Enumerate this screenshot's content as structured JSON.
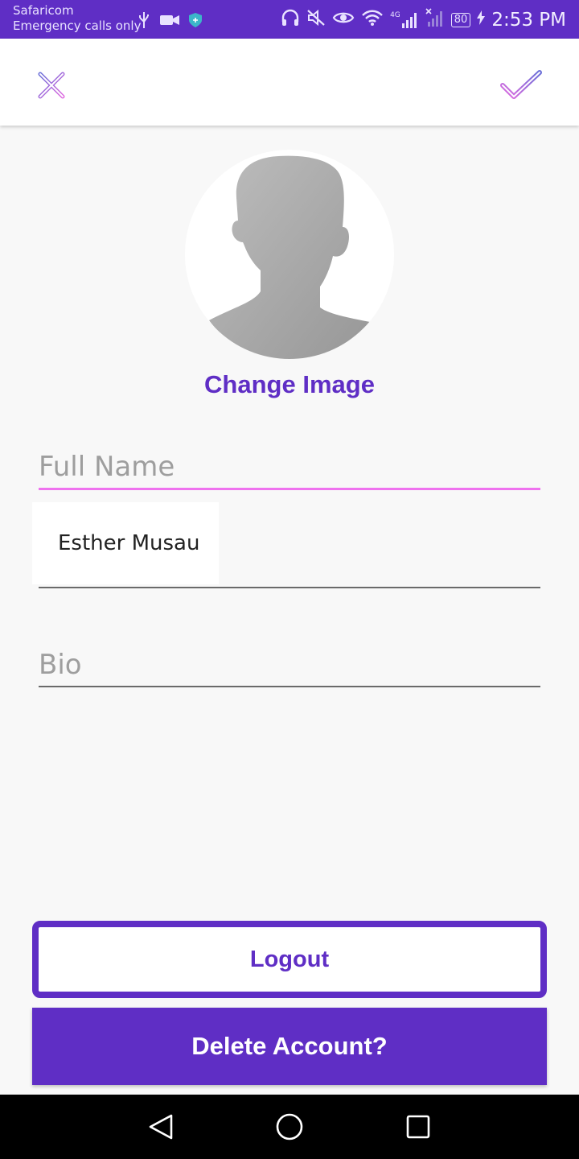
{
  "status_bar": {
    "carrier": "Safaricom",
    "emergency": "Emergency calls only",
    "battery": "80",
    "network": "4G",
    "time": "2:53 PM",
    "icons": [
      "usb-icon",
      "video-icon",
      "shield-icon",
      "headphones-icon",
      "mute-icon",
      "eye-icon",
      "wifi-icon",
      "signal-icon",
      "signal-off-icon",
      "battery-icon",
      "charging-icon"
    ]
  },
  "header": {
    "close_icon": "close-icon",
    "confirm_icon": "check-icon"
  },
  "profile": {
    "avatar_icon": "avatar-placeholder-icon",
    "change_image_label": "Change Image"
  },
  "form": {
    "full_name_label": "Full Name",
    "full_name_value": "Esther Musau",
    "bio_label": "Bio"
  },
  "actions": {
    "logout_label": "Logout",
    "delete_label": "Delete Account?"
  },
  "nav": {
    "icons": [
      "back-icon",
      "home-icon",
      "recents-icon"
    ]
  },
  "colors": {
    "primary": "#5f2ec5",
    "accent_underline": "#ef72ef",
    "background": "#f8f8f8"
  }
}
